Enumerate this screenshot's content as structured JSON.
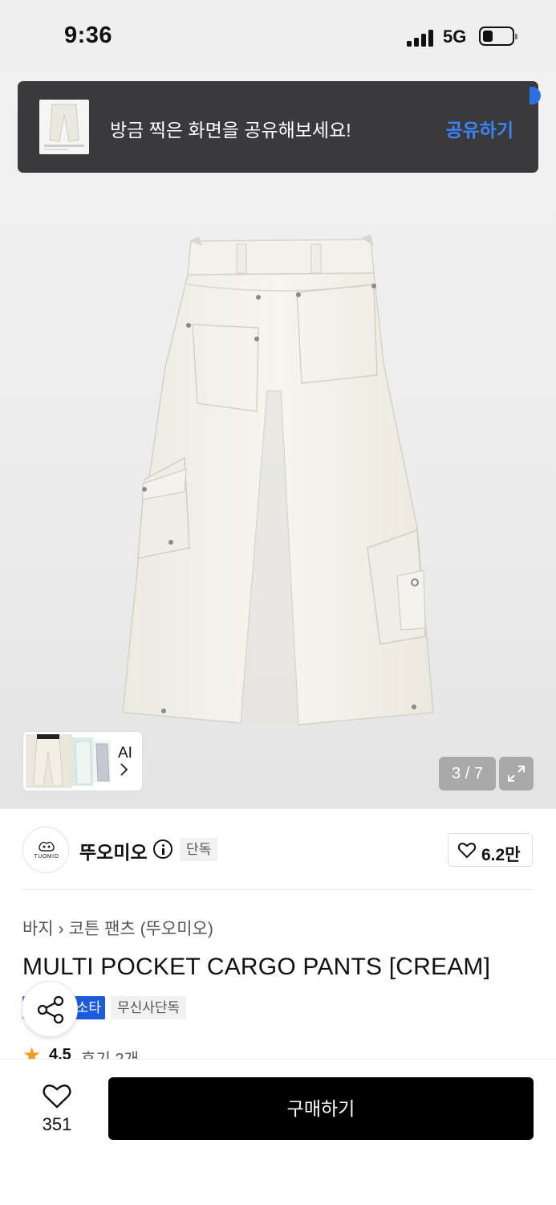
{
  "status_bar": {
    "time": "9:36",
    "network": "5G",
    "icons": [
      "signal-icon",
      "battery-icon"
    ]
  },
  "toast": {
    "message": "방금 찍은 화면을 공유해보세요!",
    "action_label": "공유하기",
    "action_color": "#3b83f6"
  },
  "gallery": {
    "ai_label": "AI",
    "counter": "3 / 7",
    "icons": [
      "chevron-right-icon",
      "expand-icon"
    ]
  },
  "brand": {
    "name": "뚜오미오",
    "badge": "단독",
    "logo_text": "TUOMIO",
    "likes": "6.2만"
  },
  "product": {
    "breadcrumb": [
      "바지",
      "코튼 팬츠 (뚜오미오)"
    ],
    "title": "MULTI POCKET CARGO PANTS [CREAM]",
    "tags": [
      "소타",
      "무신사단독"
    ],
    "rating": "4.5",
    "reviews": "후기 2개"
  },
  "bottom_bar": {
    "wish_count": "351",
    "buy_label": "구매하기"
  },
  "colors": {
    "accent_blue": "#1c5bd9",
    "toast_bg": "#3a3a3c",
    "star": "#f0a01e",
    "buy_button": "#000000"
  }
}
